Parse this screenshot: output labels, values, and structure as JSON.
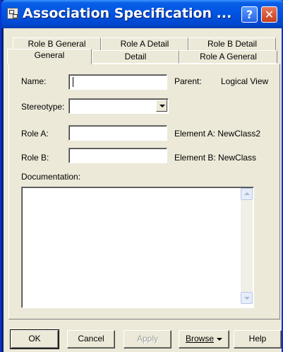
{
  "window": {
    "title": "Association Specification ...",
    "help_label": "?",
    "close_label": "✕"
  },
  "tabs": {
    "row1": [
      "Role B General",
      "Role A Detail",
      "Role B Detail"
    ],
    "row2": [
      "General",
      "Detail",
      "Role A General"
    ],
    "active": "General"
  },
  "form": {
    "name_label": "Name:",
    "name_value": "",
    "parent_label": "Parent:",
    "parent_value": "Logical View",
    "stereotype_label": "Stereotype:",
    "stereotype_value": "",
    "role_a_label": "Role A:",
    "role_a_value": "",
    "element_a": "Element A: NewClass2",
    "role_b_label": "Role B:",
    "role_b_value": "",
    "element_b": "Element B: NewClass",
    "documentation_label": "Documentation:",
    "documentation_value": ""
  },
  "buttons": {
    "ok": "OK",
    "cancel": "Cancel",
    "apply": "Apply",
    "browse": "Browse",
    "help": "Help"
  },
  "colors": {
    "titlebar": "#0054e3",
    "dialog_face": "#ece9d8",
    "close_button": "#c7401c"
  }
}
